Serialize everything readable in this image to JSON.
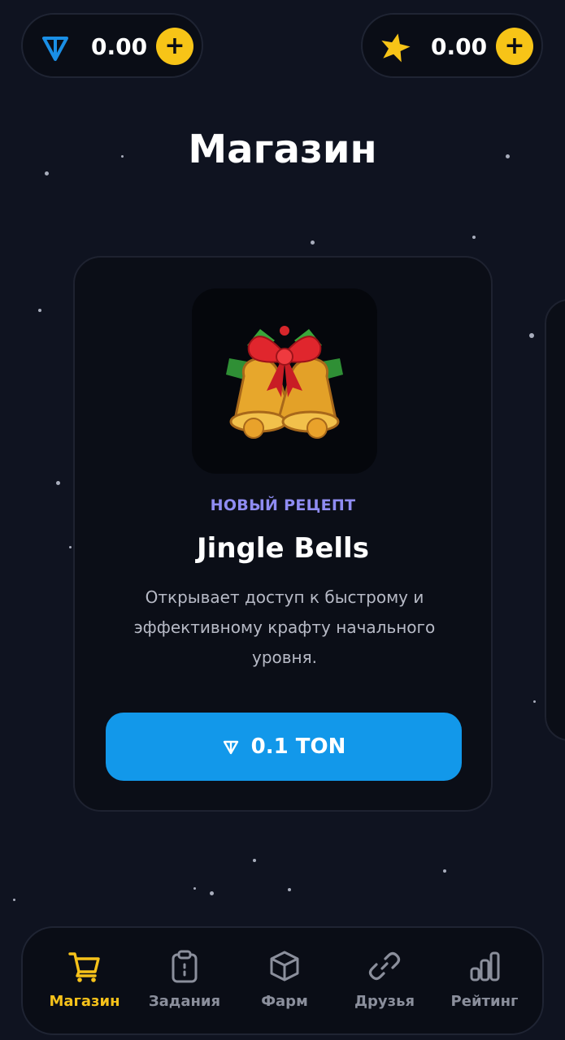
{
  "balances": {
    "ton": {
      "amount": "0.00",
      "add_label": "+",
      "icon": "ton-icon"
    },
    "stars": {
      "amount": "0.00",
      "add_label": "+",
      "icon": "star-icon"
    }
  },
  "page_title": "Магазин",
  "product": {
    "image": "jingle-bells-image",
    "tag": "НОВЫЙ РЕЦЕПТ",
    "name": "Jingle Bells",
    "description": "Открывает доступ к быстрому и эффективному крафту начального уровня.",
    "buy_label": "0.1 TON"
  },
  "nav": {
    "items": [
      {
        "label": "Магазин",
        "icon": "cart-icon",
        "active": true
      },
      {
        "label": "Задания",
        "icon": "clipboard-icon",
        "active": false
      },
      {
        "label": "Фарм",
        "icon": "cube-icon",
        "active": false
      },
      {
        "label": "Друзья",
        "icon": "link-icon",
        "active": false
      },
      {
        "label": "Рейтинг",
        "icon": "bar-chart-icon",
        "active": false
      }
    ]
  },
  "colors": {
    "background": "#0f1320",
    "accent_yellow": "#f6c21a",
    "button_blue": "#1298ea",
    "tag_purple": "#8f8cf2"
  }
}
